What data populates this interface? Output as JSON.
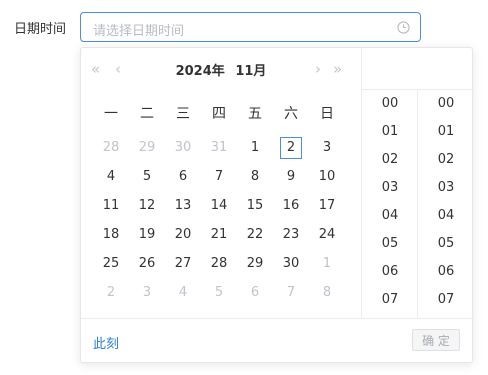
{
  "form": {
    "label": "日期时间",
    "input": {
      "placeholder": "请选择日期时间",
      "icon": "clock-icon"
    }
  },
  "calendar": {
    "year_label": "2024年",
    "month_label": "11月",
    "nav": {
      "prev_year": "«",
      "prev_month": "‹",
      "next_month": "›",
      "next_year": "»"
    },
    "weekdays": [
      "一",
      "二",
      "三",
      "四",
      "五",
      "六",
      "日"
    ],
    "weeks": [
      [
        {
          "d": "28",
          "other": true
        },
        {
          "d": "29",
          "other": true
        },
        {
          "d": "30",
          "other": true
        },
        {
          "d": "31",
          "other": true
        },
        {
          "d": "1"
        },
        {
          "d": "2",
          "selected": true
        },
        {
          "d": "3"
        }
      ],
      [
        {
          "d": "4"
        },
        {
          "d": "5"
        },
        {
          "d": "6"
        },
        {
          "d": "7"
        },
        {
          "d": "8"
        },
        {
          "d": "9"
        },
        {
          "d": "10"
        }
      ],
      [
        {
          "d": "11"
        },
        {
          "d": "12"
        },
        {
          "d": "13"
        },
        {
          "d": "14"
        },
        {
          "d": "15"
        },
        {
          "d": "16"
        },
        {
          "d": "17"
        }
      ],
      [
        {
          "d": "18"
        },
        {
          "d": "19"
        },
        {
          "d": "20"
        },
        {
          "d": "21"
        },
        {
          "d": "22"
        },
        {
          "d": "23"
        },
        {
          "d": "24"
        }
      ],
      [
        {
          "d": "25"
        },
        {
          "d": "26"
        },
        {
          "d": "27"
        },
        {
          "d": "28"
        },
        {
          "d": "29"
        },
        {
          "d": "30"
        },
        {
          "d": "1",
          "other": true
        }
      ],
      [
        {
          "d": "2",
          "other": true
        },
        {
          "d": "3",
          "other": true
        },
        {
          "d": "4",
          "other": true
        },
        {
          "d": "5",
          "other": true
        },
        {
          "d": "6",
          "other": true
        },
        {
          "d": "7",
          "other": true
        },
        {
          "d": "8",
          "other": true
        }
      ]
    ]
  },
  "time": {
    "hours": [
      "00",
      "01",
      "02",
      "03",
      "04",
      "05",
      "06",
      "07"
    ],
    "minutes": [
      "00",
      "01",
      "02",
      "03",
      "04",
      "05",
      "06",
      "07"
    ]
  },
  "footer": {
    "now_label": "此刻",
    "confirm_label": "确 定"
  },
  "colors": {
    "accent": "#4a8fd8",
    "link": "#2d7fd6",
    "muted": "#c0c4cc"
  }
}
